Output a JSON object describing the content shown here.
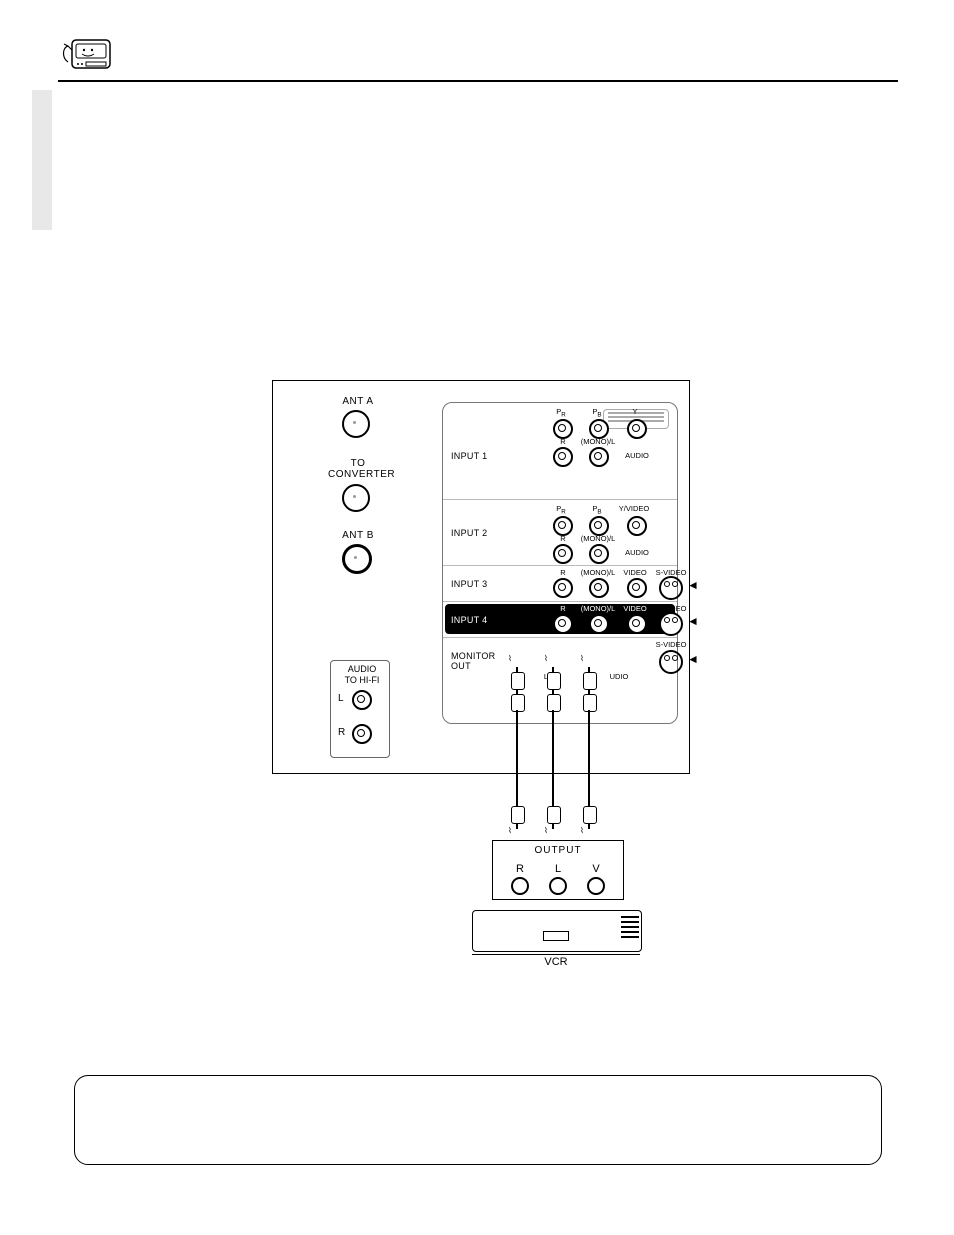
{
  "panel": {
    "ant_a": "ANT A",
    "to": "TO",
    "converter": "CONVERTER",
    "ant_b": "ANT B",
    "audio": "AUDIO",
    "to_hifi": "TO HI-FI",
    "l": "L",
    "r": "R"
  },
  "rows": {
    "input1": "INPUT 1",
    "input2": "INPUT 2",
    "input3": "INPUT 3",
    "input4": "INPUT 4",
    "monitor_out": "MONITOR\nOUT"
  },
  "labels": {
    "pr": "P",
    "pr_sub": "R",
    "pb": "P",
    "pb_sub": "B",
    "y": "Y",
    "yvideo": "Y/VIDEO",
    "r": "R",
    "mono_l": "(MONO)/L",
    "audio": "AUDIO",
    "video": "VIDEO",
    "svideo": "S-VIDEO",
    "l_audio": "L",
    "audio_inline": "UDIO"
  },
  "vcr": {
    "output": "OUTPUT",
    "r": "R",
    "l": "L",
    "v": "V",
    "name": "VCR"
  }
}
